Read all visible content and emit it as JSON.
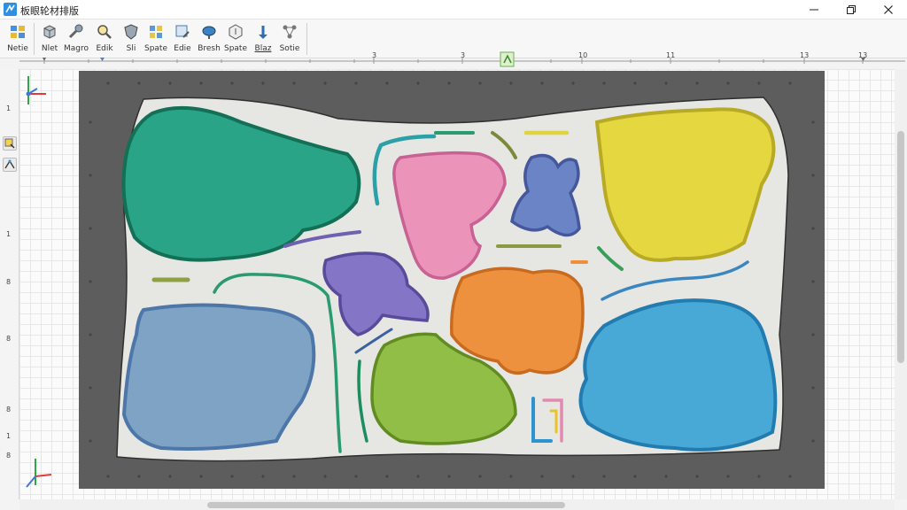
{
  "window": {
    "title": "板眼轮材排版",
    "controls": {
      "minimize": "minimize",
      "maximize": "maximize",
      "close": "close"
    }
  },
  "toolbar": {
    "items": [
      {
        "label": "Netie",
        "icon": "nest-icon"
      },
      {
        "label": "Nlet",
        "icon": "cube-icon"
      },
      {
        "label": "Magro",
        "icon": "brush-icon"
      },
      {
        "label": "Edik",
        "icon": "magnifier-icon"
      },
      {
        "label": "Sli",
        "icon": "shield-icon"
      },
      {
        "label": "Spate",
        "icon": "grid-icon"
      },
      {
        "label": "Edie",
        "icon": "edit-icon"
      },
      {
        "label": "Bresh",
        "icon": "cloud-icon"
      },
      {
        "label": "Spate",
        "icon": "hexagon-icon"
      },
      {
        "label": "Blaz",
        "icon": "pin-icon"
      },
      {
        "label": "Sotie",
        "icon": "network-icon"
      }
    ]
  },
  "ruler": {
    "top_labels": [
      "3",
      "3",
      "10",
      "11",
      "13",
      "13"
    ],
    "left_labels": [
      "1",
      "1",
      "8",
      "8",
      "8",
      "1",
      "8"
    ]
  },
  "colors": {
    "teal": "#1e9a7c",
    "pink": "#e98fb4",
    "yellow": "#e3d63f",
    "purple": "#8574c2",
    "orange": "#ec8f3e",
    "blue_gray": "#7fa2c4",
    "lime": "#8fbc45",
    "sky": "#46a6d3"
  }
}
